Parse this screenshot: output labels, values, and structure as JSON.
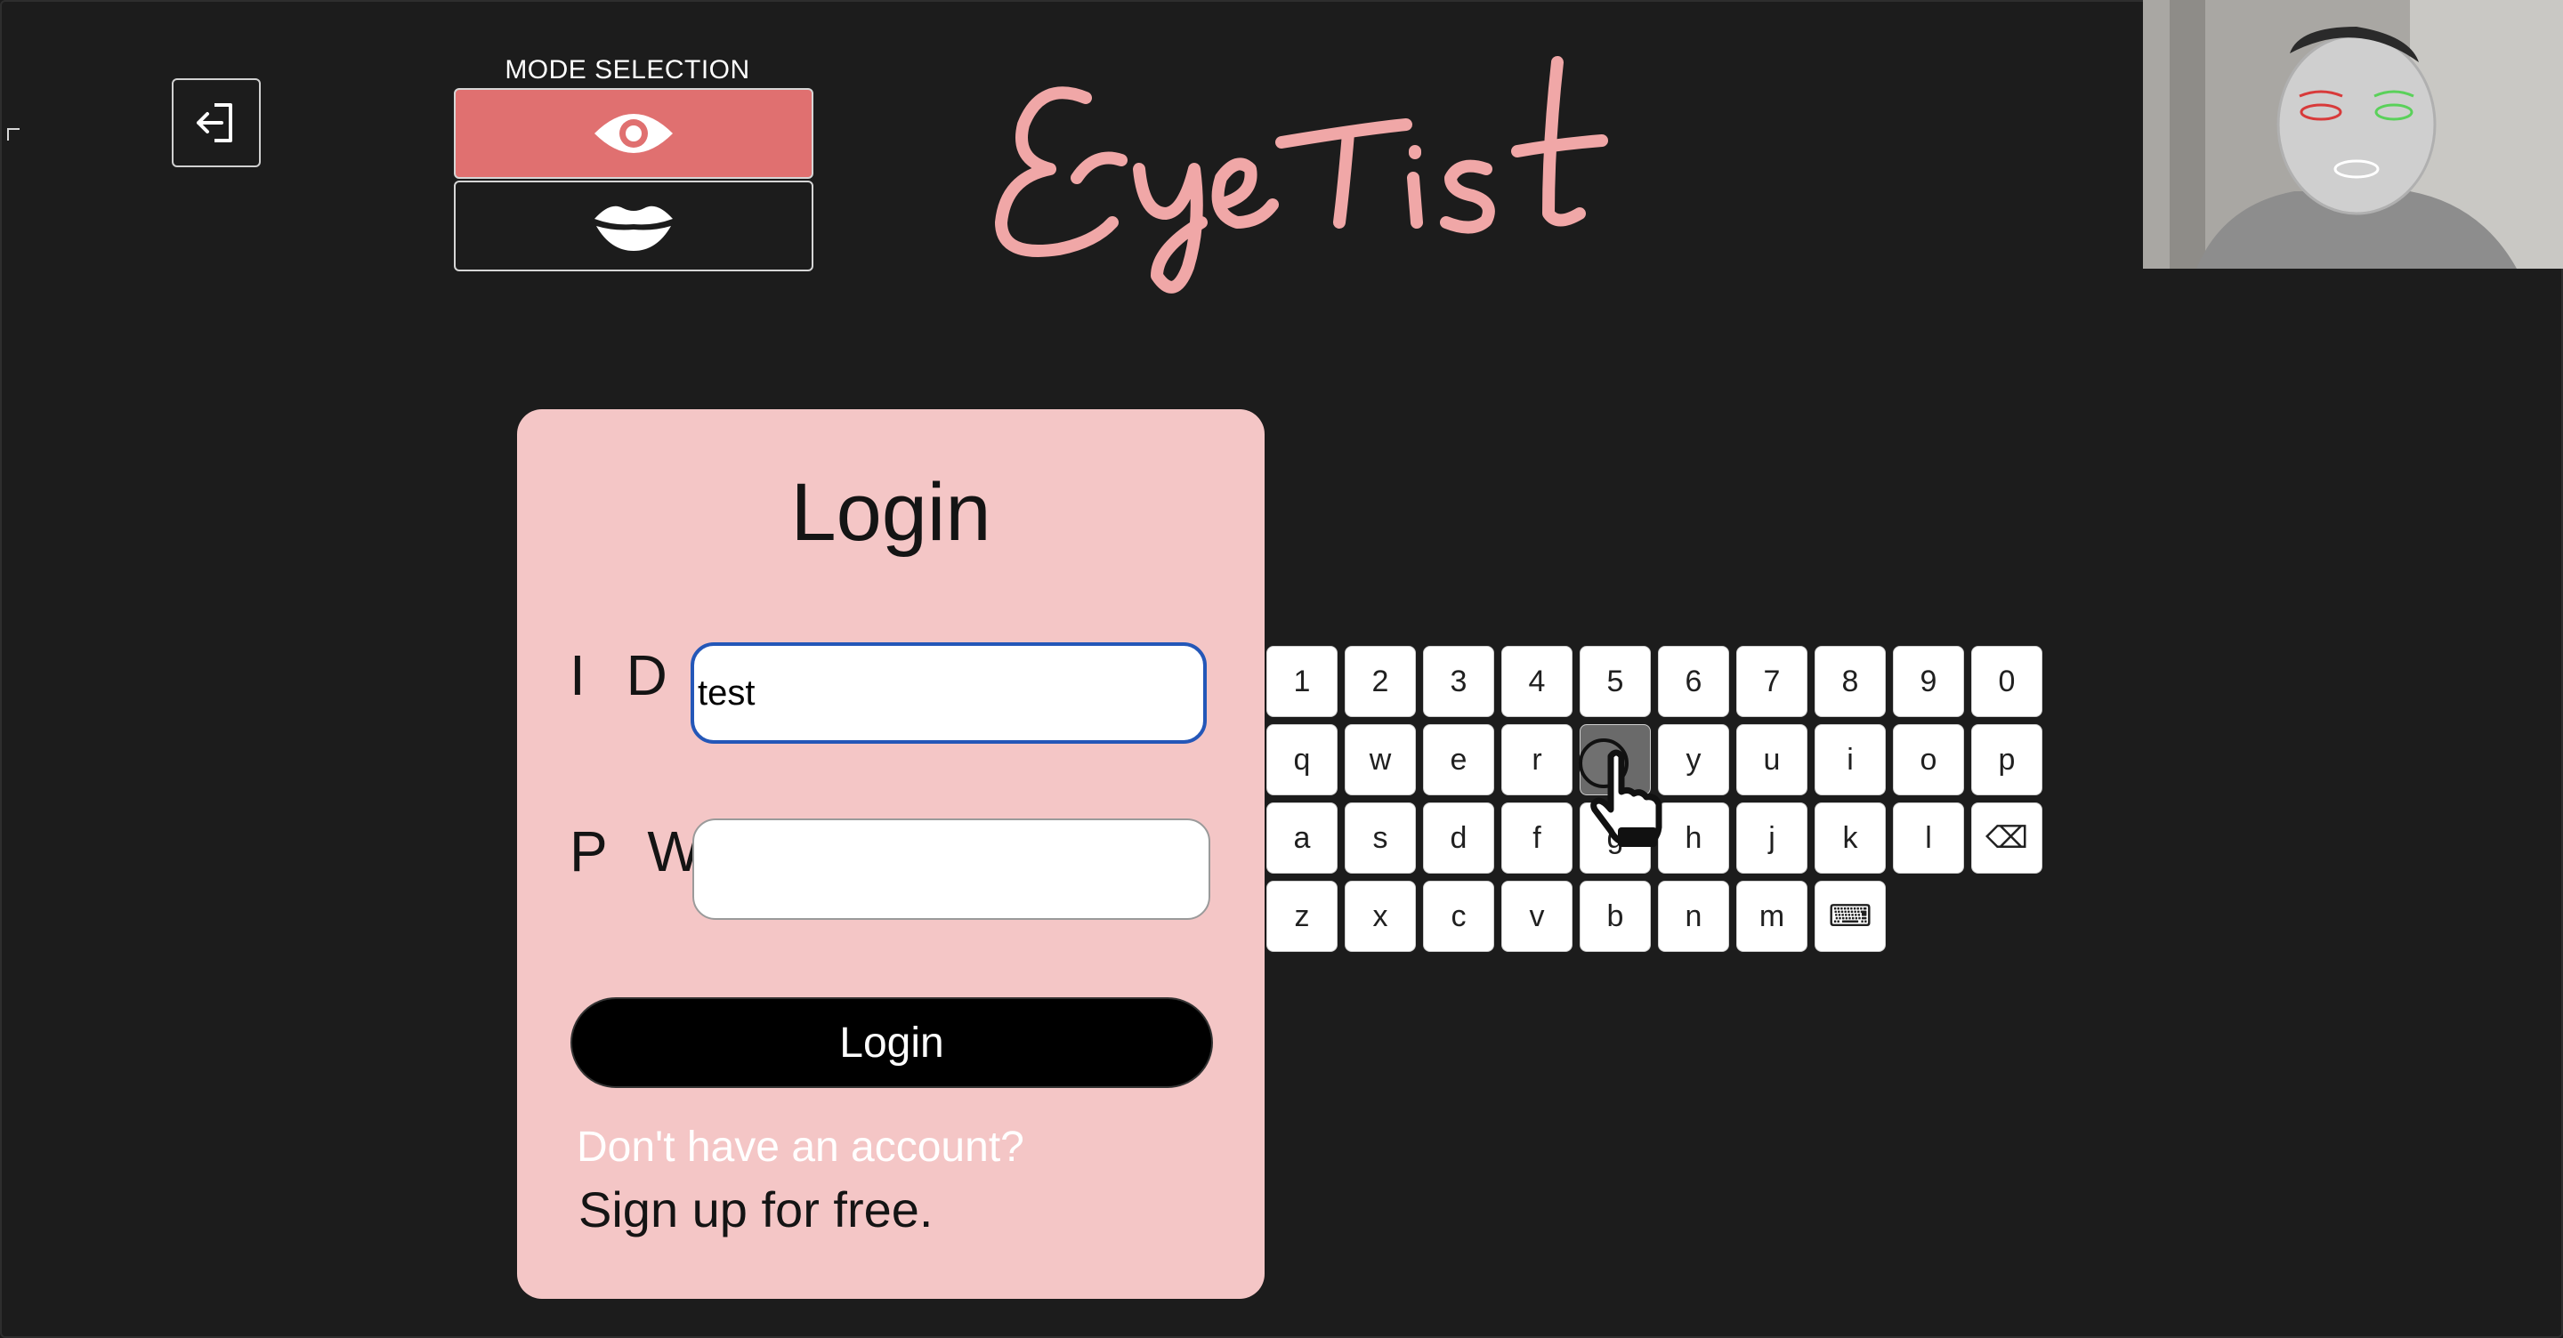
{
  "header": {
    "mode_selection_label": "MODE SELECTION",
    "modes": [
      {
        "name": "eye",
        "icon": "eye-icon",
        "selected": true
      },
      {
        "name": "lips",
        "icon": "lips-icon",
        "selected": false
      }
    ],
    "exit_icon": "exit-icon",
    "logo_text": "EyeTist"
  },
  "colors": {
    "background": "#1c1c1c",
    "card": "#f4c6c6",
    "accent": "#e07070",
    "logo": "#f0a7a7",
    "focus_border": "#2457b8"
  },
  "login": {
    "title": "Login",
    "id_label": "I D",
    "id_value": "test",
    "pw_label": "P W",
    "pw_value": "",
    "button_label": "Login",
    "no_account_text": "Don't have an account?",
    "signup_text": "Sign up for free."
  },
  "keyboard": {
    "rows": [
      [
        "1",
        "2",
        "3",
        "4",
        "5",
        "6",
        "7",
        "8",
        "9",
        "0"
      ],
      [
        "q",
        "w",
        "e",
        "r",
        "t",
        "y",
        "u",
        "i",
        "o",
        "p"
      ],
      [
        "a",
        "s",
        "d",
        "f",
        "g",
        "h",
        "j",
        "k",
        "l",
        "⌫"
      ],
      [
        "z",
        "x",
        "c",
        "v",
        "b",
        "n",
        "m",
        "⌨"
      ]
    ],
    "active_key": "t"
  }
}
